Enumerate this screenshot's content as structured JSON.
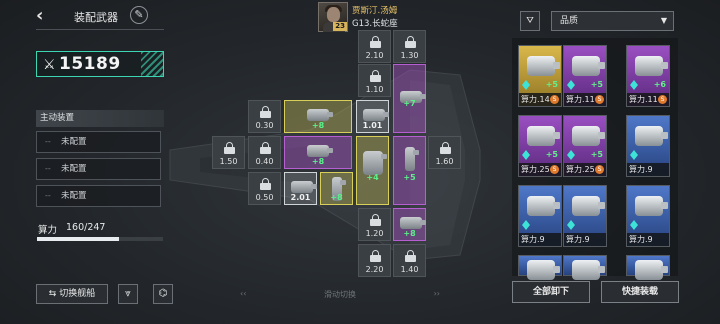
{
  "header": {
    "title": "装配武器",
    "captain_name": "贾斯汀.汤姆",
    "captain_level": "23",
    "ship_name": "G13.长蛇座"
  },
  "power": {
    "value": "15189"
  },
  "active_equip": {
    "title": "主动装置",
    "slots": [
      {
        "dash": "--",
        "label": "未配置"
      },
      {
        "dash": "--",
        "label": "未配置"
      },
      {
        "dash": "--",
        "label": "未配置"
      }
    ]
  },
  "computing": {
    "label": "算力",
    "used": 160,
    "total": 247,
    "text": "160/247"
  },
  "buttons": {
    "switch_ship": "切换舰船",
    "swipe_hint": "滑动切换",
    "unequip_all": "全部卸下",
    "quick_equip": "快捷装载"
  },
  "filter": {
    "quality_label": "品质"
  },
  "slots": {
    "locked": [
      "2.10",
      "1.30",
      "1.10",
      "0.30",
      "1.50",
      "0.40",
      "0.50",
      "1.60",
      "1.20",
      "2.20",
      "1.40"
    ],
    "equipped": [
      {
        "kind": "yellow",
        "text": "+8"
      },
      {
        "kind": "gray",
        "text": "1.01"
      },
      {
        "kind": "purple",
        "text": "+7"
      },
      {
        "kind": "purple",
        "text": "+8"
      },
      {
        "kind": "yellow",
        "text": "+4"
      },
      {
        "kind": "purple",
        "text": "+5"
      },
      {
        "kind": "gray",
        "text": "2.01"
      },
      {
        "kind": "yellow",
        "text": "+8"
      },
      {
        "kind": "purple",
        "text": "+8"
      }
    ]
  },
  "inventory": [
    {
      "quality": "gold",
      "level": "+5",
      "power": "算力.14",
      "mark": "S"
    },
    {
      "quality": "purple",
      "level": "+5",
      "power": "算力.11",
      "mark": "S"
    },
    {
      "quality": "purple",
      "level": "+6",
      "power": "算力.11",
      "mark": "S"
    },
    {
      "quality": "purple",
      "level": "+5",
      "power": "算力.25",
      "mark": "S"
    },
    {
      "quality": "purple",
      "level": "+5",
      "power": "算力.25",
      "mark": "S"
    },
    {
      "quality": "blue",
      "level": "",
      "power": "算力.9",
      "mark": ""
    },
    {
      "quality": "blue",
      "level": "",
      "power": "算力.9",
      "mark": ""
    },
    {
      "quality": "blue",
      "level": "",
      "power": "算力.9",
      "mark": ""
    },
    {
      "quality": "blue",
      "level": "",
      "power": "算力.9",
      "mark": ""
    },
    {
      "quality": "blue",
      "level": "",
      "power": "",
      "mark": ""
    },
    {
      "quality": "blue",
      "level": "",
      "power": "",
      "mark": ""
    },
    {
      "quality": "blue",
      "level": "",
      "power": "",
      "mark": ""
    }
  ],
  "colors": {
    "accent": "#3dd6b3",
    "gold": "#d9b84b",
    "purple": "#9a4fc2",
    "blue": "#4f78c9",
    "plus_green": "#5bf08a"
  }
}
